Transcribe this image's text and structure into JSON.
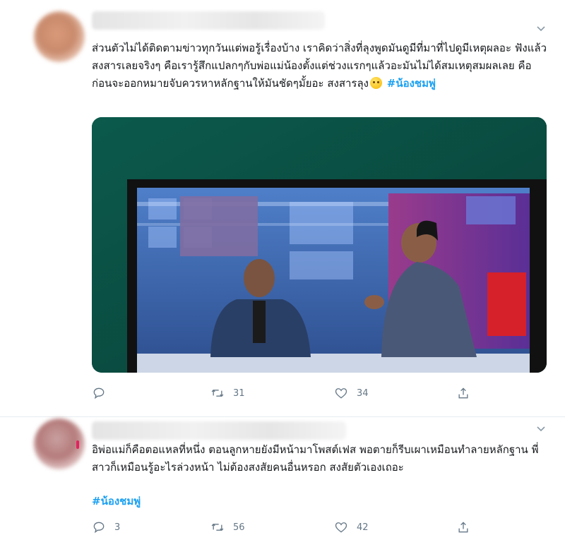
{
  "tweets": [
    {
      "text": "ส่วนตัวไม่ได้ติดตามข่าวทุกวันแต่พอรู้เรื่องบ้าง เราคิดว่าสิ่งที่ลุงพูดมันดูมีที่มาที่ไปดูมีเหตุผลอะ ฟังแล้วสงสารเลยจริงๆ คือเรารู้สึกแปลกๆกับพ่อแม่น้องตั้งแต่ช่วงแรกๆแล้วอะมันไม่ได้สมเหตุสมผลเลย คือก่อนจะออกหมายจับควรหาหลักฐานให้มันชัดๆมั้ยอะ สงสารลุง",
      "hashtag": "#น้องชมพู่",
      "reply_count": "",
      "retweet_count": "31",
      "like_count": "34"
    },
    {
      "text": "อิพ่อแม่ก็คือตอแหลที่หนึ่ง ตอนลูกหายยังมีหน้ามาโพสต์เฟส พอตายก็รีบเผาเหมือนทำลายหลักฐาน พี่สาวก็เหมือนรู้อะไรล่วงหน้า ไม่ต้องสงสัยคนอื่นหรอก สงสัยตัวเองเถอะ",
      "hashtag": "#น้องชมพู่",
      "reply_count": "3",
      "retweet_count": "56",
      "like_count": "42"
    }
  ],
  "icons": {
    "reply": "reply-icon",
    "retweet": "retweet-icon",
    "like": "like-icon",
    "share": "share-icon",
    "caret": "chevron-down-icon",
    "emoji": "emoji-icon"
  },
  "colors": {
    "hashtag": "#1da1f2",
    "icon_gray": "#657786",
    "text": "#14171a",
    "divider": "#e6ecf0"
  }
}
